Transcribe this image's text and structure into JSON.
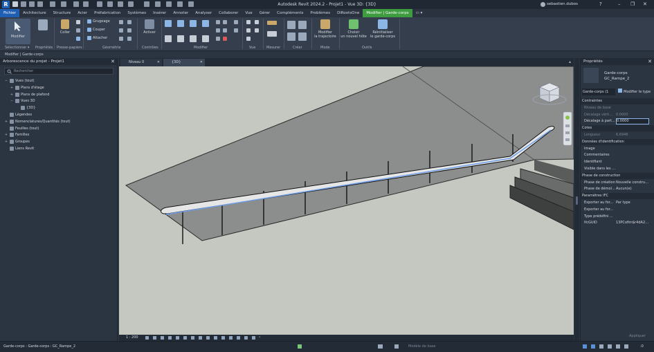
{
  "titlebar": {
    "app_logo": "R",
    "title": "Autodesk Revit 2024.2 - Projet1 - Vue 3D: {3D}",
    "user": "sebastien.dubos",
    "help": "?",
    "minimize": "–",
    "maximize": "❐",
    "close": "✕"
  },
  "tabs": [
    "Fichier",
    "Architecture",
    "Structure",
    "Acier",
    "Préfabrication",
    "Systèmes",
    "Insérer",
    "Annoter",
    "Analyser",
    "Collaborer",
    "Vue",
    "Gérer",
    "Compléments",
    "Problèmes",
    "DiRootsOne",
    "Modifier | Garde-corps"
  ],
  "ribbon": {
    "modifier": "Modifier",
    "proprietes": "Propriétés",
    "coller": "Coller",
    "grugeage": "Grugeage",
    "couper": "Couper",
    "attacher": "Attacher",
    "activer": "Activer",
    "modifier_trajectoire": "Modifier\nla trajectoire",
    "choisir_hote": "Choisir\nun nouvel hôte",
    "reinitialiser": "Réinitialiser\nle garde-corps",
    "groups": {
      "selectionner": "Sélectionner ▾",
      "proprietes": "Propriétés",
      "presse_papiers": "Presse-papiers",
      "geometrie": "Géométrie",
      "controles": "Contrôles",
      "modifier": "Modifier",
      "vue": "Vue",
      "mesurer": "Mesurer",
      "creer": "Créer",
      "mode": "Mode",
      "outils": "Outils"
    }
  },
  "context_bar": "Modifier | Garde-corps",
  "browser": {
    "title": "Arborescence du projet - Projet1",
    "close": "✕",
    "search_placeholder": "Rechercher",
    "items": [
      {
        "toggle": "−",
        "label": "Vues (tout)",
        "indent": 0
      },
      {
        "toggle": "+",
        "label": "Plans d'étage",
        "indent": 1
      },
      {
        "toggle": "+",
        "label": "Plans de plafond",
        "indent": 1
      },
      {
        "toggle": "−",
        "label": "Vues 3D",
        "indent": 1
      },
      {
        "toggle": "",
        "label": "{3D}",
        "indent": 2
      },
      {
        "toggle": "",
        "label": "Légendes",
        "indent": 0
      },
      {
        "toggle": "+",
        "label": "Nomenclatures/Quantités (tout)",
        "indent": 0
      },
      {
        "toggle": "",
        "label": "Feuilles (tout)",
        "indent": 0
      },
      {
        "toggle": "+",
        "label": "Familles",
        "indent": 0
      },
      {
        "toggle": "+",
        "label": "Groupes",
        "indent": 0
      },
      {
        "toggle": "",
        "label": "Liens Revit",
        "indent": 0
      }
    ]
  },
  "view_tabs": [
    {
      "label": "Niveau 0",
      "close": "✕"
    },
    {
      "label": "{3D}",
      "close": "✕"
    }
  ],
  "view_bar": {
    "scale": "1 : 200",
    "arrow": "‹"
  },
  "properties": {
    "title": "Propriétés",
    "close": "✕",
    "type_name": "Garde-corps",
    "type_sub": "GC_Rampe_2",
    "selector": "Garde-corps (1",
    "edit_type": "Modifier le type",
    "rows": [
      {
        "kind": "section",
        "label": "Contraintes"
      },
      {
        "kind": "row",
        "label": "Niveau de base",
        "value": "",
        "dim": true
      },
      {
        "kind": "row",
        "label": "Décalage vérti...",
        "value": "0.0000",
        "dim": true
      },
      {
        "kind": "row",
        "label": "Décalage à part...",
        "value": "0.0000",
        "dim": false,
        "boxed": true
      },
      {
        "kind": "section",
        "label": "Cotes"
      },
      {
        "kind": "row",
        "label": "Longueur",
        "value": "6.6946",
        "dim": true
      },
      {
        "kind": "section",
        "label": "Données d'identification"
      },
      {
        "kind": "row",
        "label": "Image",
        "value": "",
        "dim": false
      },
      {
        "kind": "row",
        "label": "Commentaires",
        "value": "",
        "dim": false
      },
      {
        "kind": "row",
        "label": "Identifiant",
        "value": "",
        "dim": false
      },
      {
        "kind": "row",
        "label": "Visible dans les ...",
        "value": "",
        "dim": false
      },
      {
        "kind": "section",
        "label": "Phase de construction"
      },
      {
        "kind": "row",
        "label": "Phase de création",
        "value": "Nouvelle constru...",
        "dim": false
      },
      {
        "kind": "row",
        "label": "Phase de démol...",
        "value": "Aucun(e)",
        "dim": false
      },
      {
        "kind": "section",
        "label": "Paramètres IFC"
      },
      {
        "kind": "row",
        "label": "Exporter au for...",
        "value": "Par type",
        "dim": false
      },
      {
        "kind": "row",
        "label": "Exporter au for...",
        "value": "",
        "dim": false
      },
      {
        "kind": "row",
        "label": "Type prédéfini ...",
        "value": "",
        "dim": false
      },
      {
        "kind": "row",
        "label": "IfcGUID",
        "value": "13PCofim$r4dA2...",
        "dim": false
      }
    ],
    "apply": "Appliquer"
  },
  "status": {
    "left": "Garde-corps : Garde-corps : GC_Rampe_2",
    "model": "Modèle de base",
    "zero": ":0"
  },
  "colors": {
    "accent": "#1e5fb4",
    "active_tab": "#3f9b3f",
    "railing_highlight": "#6f9ee8"
  }
}
